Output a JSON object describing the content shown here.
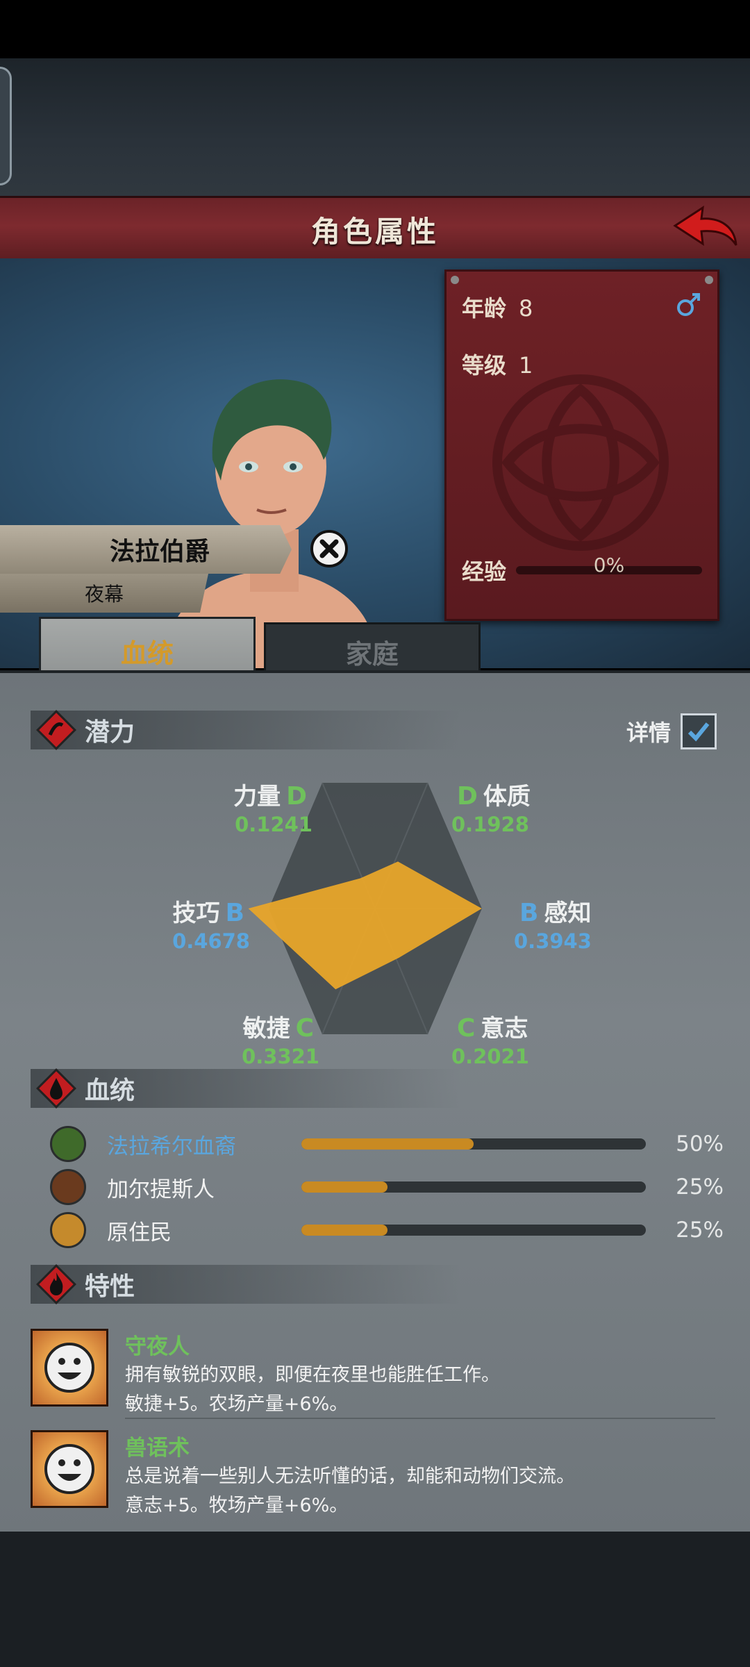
{
  "header": {
    "title": "角色属性"
  },
  "character": {
    "name": "法拉伯爵",
    "house": "夜幕",
    "age_label": "年龄",
    "age_value": "8",
    "level_label": "等级",
    "level_value": "1",
    "exp_label": "经验",
    "exp_value": "0%",
    "gender_icon": "male-icon"
  },
  "tabs": [
    {
      "label": "血统",
      "active": true
    },
    {
      "label": "家庭",
      "active": false
    }
  ],
  "potential": {
    "title": "潜力",
    "detail_label": "详情",
    "detail_checked": true,
    "attributes": [
      {
        "name": "力量",
        "grade": "D",
        "value": "0.1241",
        "color": "#6fc15c"
      },
      {
        "name": "体质",
        "grade": "D",
        "value": "0.1928",
        "color": "#6fc15c"
      },
      {
        "name": "技巧",
        "grade": "B",
        "value": "0.4678",
        "color": "#5aa6de"
      },
      {
        "name": "感知",
        "grade": "B",
        "value": "0.3943",
        "color": "#5aa6de"
      },
      {
        "name": "敏捷",
        "grade": "C",
        "value": "0.3321",
        "color": "#6fc15c"
      },
      {
        "name": "意志",
        "grade": "C",
        "value": "0.2021",
        "color": "#6fc15c"
      }
    ],
    "radar_color": "#e8a52a"
  },
  "bloodline": {
    "title": "血统",
    "items": [
      {
        "name": "法拉希尔血裔",
        "percent": "50%",
        "fraction": 0.5,
        "name_color": "#5aa6de",
        "icon": "tree-icon"
      },
      {
        "name": "加尔提斯人",
        "percent": "25%",
        "fraction": 0.25,
        "name_color": "#f2f2f2",
        "icon": "beast-icon"
      },
      {
        "name": "原住民",
        "percent": "25%",
        "fraction": 0.25,
        "name_color": "#f2f2f2",
        "icon": "leaf-icon"
      }
    ]
  },
  "traits": {
    "title": "特性",
    "items": [
      {
        "name": "守夜人",
        "desc": "拥有敏锐的双眼，即便在夜里也能胜任工作。",
        "effect": "敏捷+5。农场产量+6%。"
      },
      {
        "name": "兽语术",
        "desc": "总是说着一些别人无法听懂的话，却能和动物们交流。",
        "effect": "意志+5。牧场产量+6%。"
      }
    ]
  }
}
